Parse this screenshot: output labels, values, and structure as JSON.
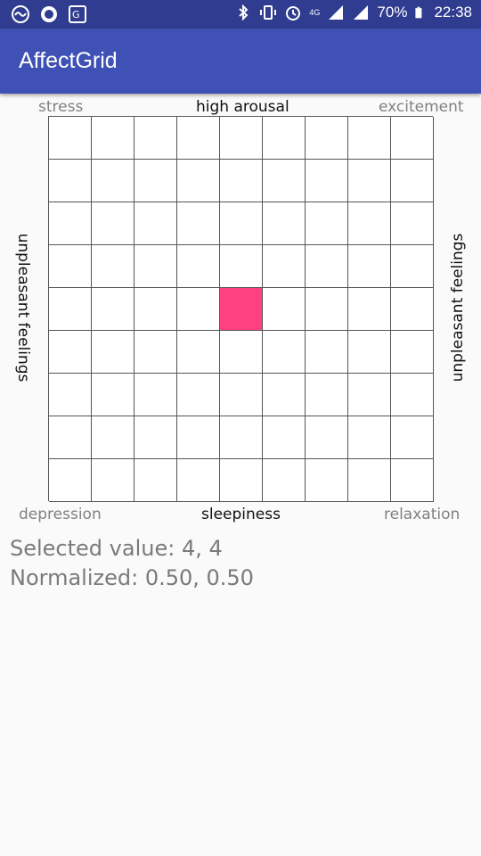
{
  "status_bar": {
    "battery": "70%",
    "time": "22:38",
    "network": "4G",
    "left_icons": [
      "sync-circle-icon",
      "record-icon",
      "translate-icon"
    ],
    "right_icons": [
      "bluetooth-icon",
      "vibrate-icon",
      "alarm-icon",
      "signal-icon",
      "battery-icon"
    ]
  },
  "appbar": {
    "title": "AffectGrid"
  },
  "grid": {
    "corners": {
      "top_left": "stress",
      "top_right": "excitement",
      "bottom_left": "depression",
      "bottom_right": "relaxation"
    },
    "axes": {
      "top": "high arousal",
      "bottom": "sleepiness",
      "left": "unpleasant feelings",
      "right": "unpleasant feelings"
    },
    "rows": 9,
    "cols": 9,
    "selected": {
      "row": 4,
      "col": 4
    },
    "selected_color": "#ff4081"
  },
  "info": {
    "selected_value": "Selected value: 4, 4",
    "normalized": "Normalized: 0.50, 0.50"
  }
}
